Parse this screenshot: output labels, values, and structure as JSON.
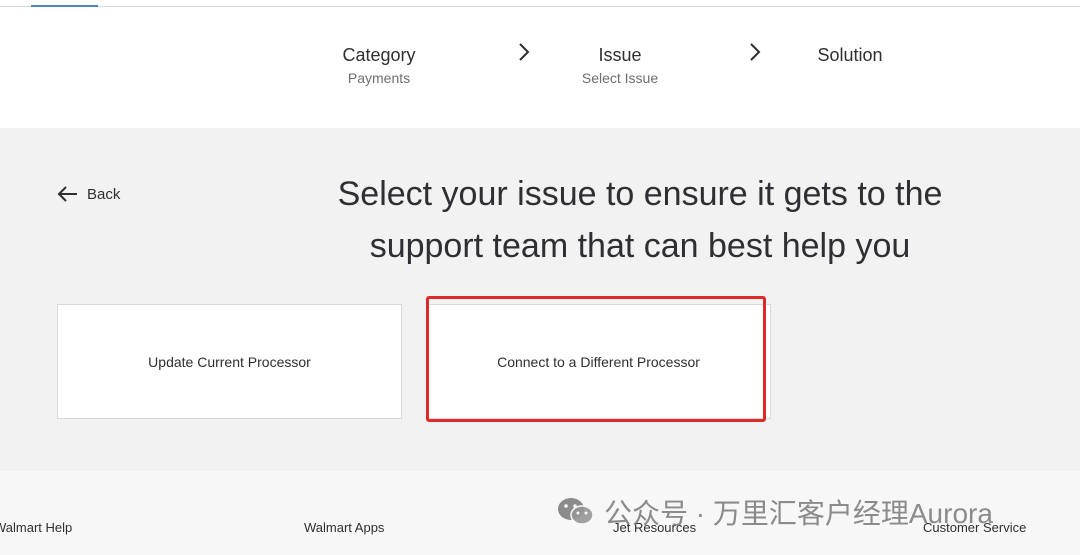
{
  "stepper": {
    "steps": [
      {
        "title": "Category",
        "subtitle": "Payments"
      },
      {
        "title": "Issue",
        "subtitle": "Select Issue"
      },
      {
        "title": "Solution",
        "subtitle": ""
      }
    ]
  },
  "main": {
    "back_label": "Back",
    "headline_line1": "Select your issue to ensure it gets to the",
    "headline_line2": "support team that can best help you",
    "options": [
      {
        "label": "Update Current Processor"
      },
      {
        "label": "Connect to a Different Processor"
      }
    ],
    "highlight_color": "#e02a2a"
  },
  "footer": {
    "links": [
      "Walmart Help",
      "Walmart Apps",
      "Jet Resources",
      "Customer Service"
    ]
  },
  "watermark": {
    "text": "公众号 · 万里汇客户经理Aurora",
    "icon": "wechat-icon"
  },
  "colors": {
    "accent": "#4a86c5",
    "background": "#f2f2f2",
    "text": "#2e2f32"
  }
}
